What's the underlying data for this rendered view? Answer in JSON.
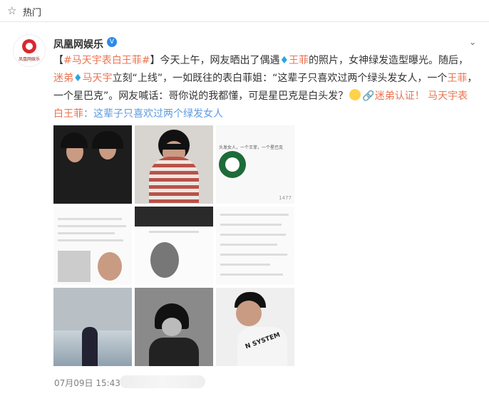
{
  "topbar": {
    "title": "热门"
  },
  "author": {
    "name": "凤凰网娱乐",
    "logo_text": "凤凰网娱乐"
  },
  "post": {
    "t1": "【",
    "tag1": "#马天宇表白王菲#",
    "t2": "】今天上午，网友晒出了偶遇",
    "diamond1": "♦",
    "mention1": "王菲",
    "t3": "的照片，女神绿发造型曝光。随后，",
    "mention2": "迷弟",
    "diamond2": "♦",
    "mention3": "马天宇",
    "t4": "立刻“上线”，一如既往的表白菲姐：“这辈子只喜欢过两个绿头发女人，一个",
    "mention4": "王菲",
    "t5": "，一个星巴克”。网友喊话：哥你说的我都懂，可是星巴克是白头发？",
    "link_icon": "🔗",
    "link_text": "迷弟认证！",
    "tag2": "马天宇表白王菲",
    "tail": "：这辈子只喜欢过两个绿发女人"
  },
  "images": {
    "c3_caption": "头发女人，一个王菲，一个星巴克",
    "c3_badge": "1477"
  },
  "meta": {
    "time": "07月09日 15:43"
  },
  "icons": {
    "star": "star-icon",
    "caret": "chevron-down-icon",
    "verified": "verified-icon"
  }
}
